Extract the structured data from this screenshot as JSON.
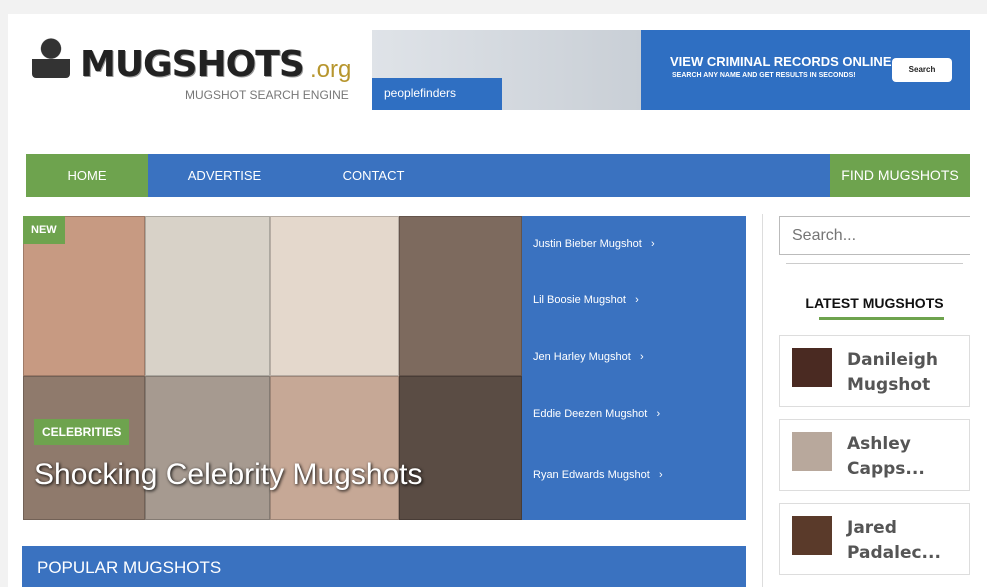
{
  "header": {
    "logo_text": "MUGSHOTS",
    "logo_tld": ".org",
    "tagline": "MUGSHOT SEARCH ENGINE"
  },
  "ad": {
    "brand": "peoplefinders",
    "headline": "VIEW CRIMINAL RECORDS ONLINE",
    "subline": "SEARCH ANY NAME AND GET RESULTS IN SECONDS!",
    "button": "Search"
  },
  "nav": {
    "items": [
      "HOME",
      "ADVERTISE",
      "CONTACT"
    ],
    "cta": "FIND MUGSHOTS"
  },
  "hero": {
    "badge": "NEW",
    "category": "CELEBRITIES",
    "title": "Shocking Celebrity Mugshots",
    "links": [
      "Justin Bieber Mugshot",
      "Lil Boosie Mugshot",
      "Jen Harley Mugshot",
      "Eddie Deezen Mugshot",
      "Ryan Edwards Mugshot"
    ]
  },
  "sidebar": {
    "search_placeholder": "Search...",
    "latest_title": "LATEST MUGSHOTS",
    "latest": [
      {
        "name": "Danileigh Mugshot"
      },
      {
        "name": "Ashley Capps..."
      },
      {
        "name": "Jared Padalec..."
      }
    ]
  },
  "popular": {
    "title": "POPULAR MUGSHOTS"
  },
  "colors": {
    "blue": "#3a72c0",
    "green": "#6ea34e"
  }
}
